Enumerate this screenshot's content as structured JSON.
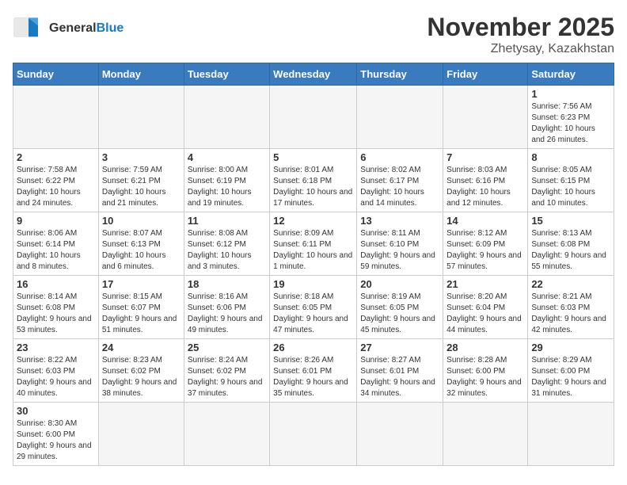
{
  "logo": {
    "text_general": "General",
    "text_blue": "Blue"
  },
  "title": "November 2025",
  "location": "Zhetysay, Kazakhstan",
  "days_of_week": [
    "Sunday",
    "Monday",
    "Tuesday",
    "Wednesday",
    "Thursday",
    "Friday",
    "Saturday"
  ],
  "weeks": [
    [
      {
        "day": "",
        "info": ""
      },
      {
        "day": "",
        "info": ""
      },
      {
        "day": "",
        "info": ""
      },
      {
        "day": "",
        "info": ""
      },
      {
        "day": "",
        "info": ""
      },
      {
        "day": "",
        "info": ""
      },
      {
        "day": "1",
        "info": "Sunrise: 7:56 AM\nSunset: 6:23 PM\nDaylight: 10 hours and 26 minutes."
      }
    ],
    [
      {
        "day": "2",
        "info": "Sunrise: 7:58 AM\nSunset: 6:22 PM\nDaylight: 10 hours and 24 minutes."
      },
      {
        "day": "3",
        "info": "Sunrise: 7:59 AM\nSunset: 6:21 PM\nDaylight: 10 hours and 21 minutes."
      },
      {
        "day": "4",
        "info": "Sunrise: 8:00 AM\nSunset: 6:19 PM\nDaylight: 10 hours and 19 minutes."
      },
      {
        "day": "5",
        "info": "Sunrise: 8:01 AM\nSunset: 6:18 PM\nDaylight: 10 hours and 17 minutes."
      },
      {
        "day": "6",
        "info": "Sunrise: 8:02 AM\nSunset: 6:17 PM\nDaylight: 10 hours and 14 minutes."
      },
      {
        "day": "7",
        "info": "Sunrise: 8:03 AM\nSunset: 6:16 PM\nDaylight: 10 hours and 12 minutes."
      },
      {
        "day": "8",
        "info": "Sunrise: 8:05 AM\nSunset: 6:15 PM\nDaylight: 10 hours and 10 minutes."
      }
    ],
    [
      {
        "day": "9",
        "info": "Sunrise: 8:06 AM\nSunset: 6:14 PM\nDaylight: 10 hours and 8 minutes."
      },
      {
        "day": "10",
        "info": "Sunrise: 8:07 AM\nSunset: 6:13 PM\nDaylight: 10 hours and 6 minutes."
      },
      {
        "day": "11",
        "info": "Sunrise: 8:08 AM\nSunset: 6:12 PM\nDaylight: 10 hours and 3 minutes."
      },
      {
        "day": "12",
        "info": "Sunrise: 8:09 AM\nSunset: 6:11 PM\nDaylight: 10 hours and 1 minute."
      },
      {
        "day": "13",
        "info": "Sunrise: 8:11 AM\nSunset: 6:10 PM\nDaylight: 9 hours and 59 minutes."
      },
      {
        "day": "14",
        "info": "Sunrise: 8:12 AM\nSunset: 6:09 PM\nDaylight: 9 hours and 57 minutes."
      },
      {
        "day": "15",
        "info": "Sunrise: 8:13 AM\nSunset: 6:08 PM\nDaylight: 9 hours and 55 minutes."
      }
    ],
    [
      {
        "day": "16",
        "info": "Sunrise: 8:14 AM\nSunset: 6:08 PM\nDaylight: 9 hours and 53 minutes."
      },
      {
        "day": "17",
        "info": "Sunrise: 8:15 AM\nSunset: 6:07 PM\nDaylight: 9 hours and 51 minutes."
      },
      {
        "day": "18",
        "info": "Sunrise: 8:16 AM\nSunset: 6:06 PM\nDaylight: 9 hours and 49 minutes."
      },
      {
        "day": "19",
        "info": "Sunrise: 8:18 AM\nSunset: 6:05 PM\nDaylight: 9 hours and 47 minutes."
      },
      {
        "day": "20",
        "info": "Sunrise: 8:19 AM\nSunset: 6:05 PM\nDaylight: 9 hours and 45 minutes."
      },
      {
        "day": "21",
        "info": "Sunrise: 8:20 AM\nSunset: 6:04 PM\nDaylight: 9 hours and 44 minutes."
      },
      {
        "day": "22",
        "info": "Sunrise: 8:21 AM\nSunset: 6:03 PM\nDaylight: 9 hours and 42 minutes."
      }
    ],
    [
      {
        "day": "23",
        "info": "Sunrise: 8:22 AM\nSunset: 6:03 PM\nDaylight: 9 hours and 40 minutes."
      },
      {
        "day": "24",
        "info": "Sunrise: 8:23 AM\nSunset: 6:02 PM\nDaylight: 9 hours and 38 minutes."
      },
      {
        "day": "25",
        "info": "Sunrise: 8:24 AM\nSunset: 6:02 PM\nDaylight: 9 hours and 37 minutes."
      },
      {
        "day": "26",
        "info": "Sunrise: 8:26 AM\nSunset: 6:01 PM\nDaylight: 9 hours and 35 minutes."
      },
      {
        "day": "27",
        "info": "Sunrise: 8:27 AM\nSunset: 6:01 PM\nDaylight: 9 hours and 34 minutes."
      },
      {
        "day": "28",
        "info": "Sunrise: 8:28 AM\nSunset: 6:00 PM\nDaylight: 9 hours and 32 minutes."
      },
      {
        "day": "29",
        "info": "Sunrise: 8:29 AM\nSunset: 6:00 PM\nDaylight: 9 hours and 31 minutes."
      }
    ],
    [
      {
        "day": "30",
        "info": "Sunrise: 8:30 AM\nSunset: 6:00 PM\nDaylight: 9 hours and 29 minutes."
      },
      {
        "day": "",
        "info": ""
      },
      {
        "day": "",
        "info": ""
      },
      {
        "day": "",
        "info": ""
      },
      {
        "day": "",
        "info": ""
      },
      {
        "day": "",
        "info": ""
      },
      {
        "day": "",
        "info": ""
      }
    ]
  ]
}
